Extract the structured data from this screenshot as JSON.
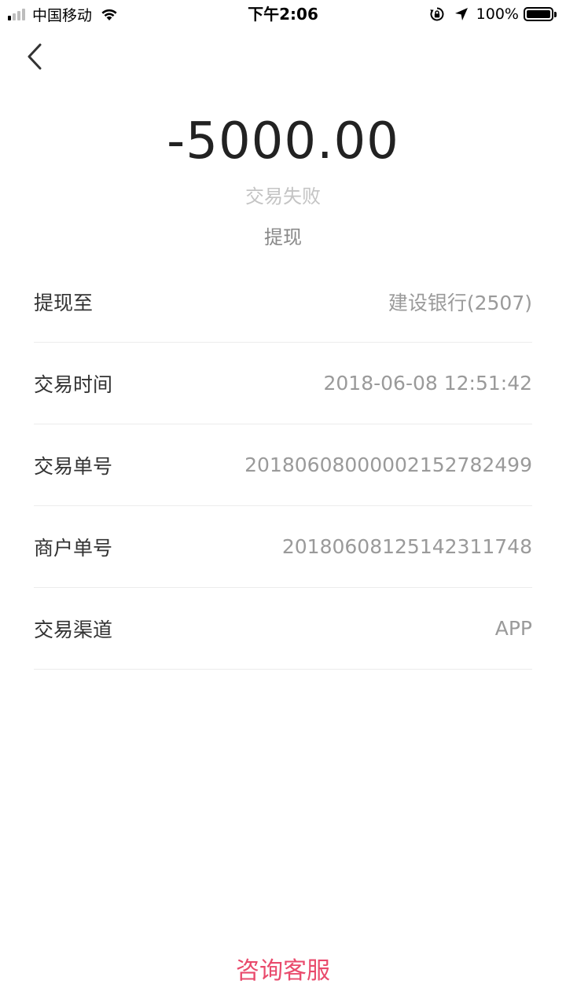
{
  "status_bar": {
    "carrier": "中国移动",
    "time": "下午2:06",
    "battery": "100%",
    "battery_level": 1.0,
    "icons": [
      "signal-icon",
      "wifi-icon",
      "rotation-lock-icon",
      "location-icon",
      "battery-icon"
    ]
  },
  "nav": {
    "back_icon": "chevron-left-icon"
  },
  "transaction": {
    "amount": "-5000.00",
    "status": "交易失败",
    "type": "提现"
  },
  "details": [
    {
      "label": "提现至",
      "value": "建设银行(2507)"
    },
    {
      "label": "交易时间",
      "value": "2018-06-08 12:51:42"
    },
    {
      "label": "交易单号",
      "value": "20180608000002152782499"
    },
    {
      "label": "商户单号",
      "value": "20180608125142311748"
    },
    {
      "label": "交易渠道",
      "value": "APP"
    }
  ],
  "footer": {
    "service_label": "咨询客服"
  },
  "colors": {
    "accent": "#e94a6c",
    "amount": "#222222",
    "status": "#c4c4c4",
    "value": "#9a9a9a"
  }
}
